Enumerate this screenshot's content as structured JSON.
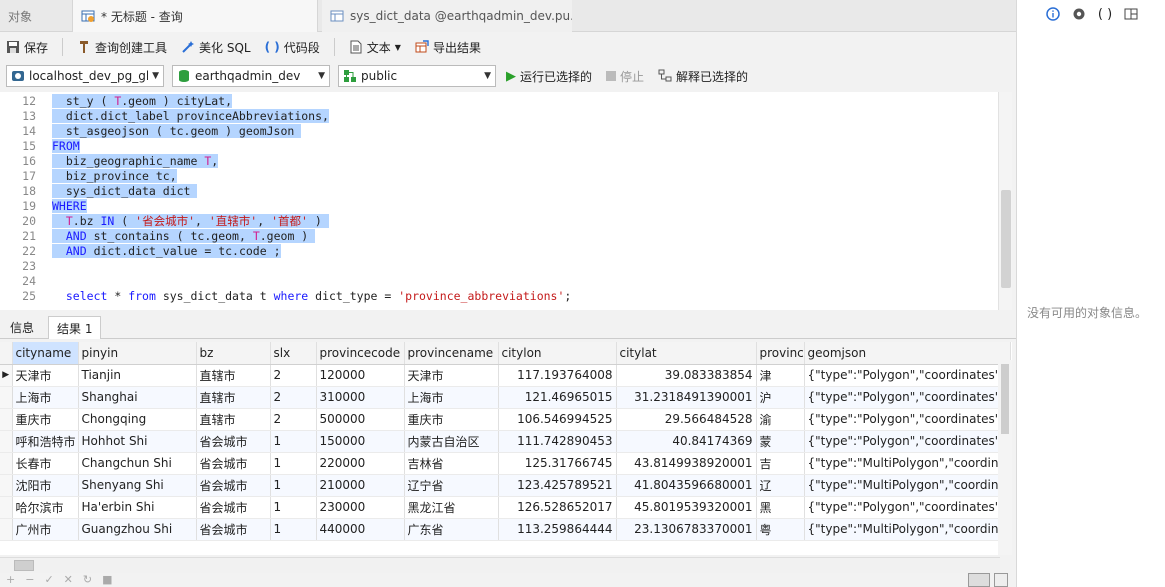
{
  "tabs": {
    "objects": "对象",
    "query": "* 无标题 - 查询",
    "dict": "sys_dict_data @earthqadmin_dev.pu..."
  },
  "toolbar": {
    "save": "保存",
    "query_builder": "查询创建工具",
    "beautify": "美化 SQL",
    "code_snippet": "代码段",
    "text": "文本",
    "export": "导出结果"
  },
  "connection": {
    "server": "localhost_dev_pg_gl",
    "database": "earthqadmin_dev",
    "schema": "public",
    "run": "运行已选择的",
    "stop": "停止",
    "explain": "解释已选择的"
  },
  "editor": {
    "line_numbers": [
      "12",
      "13",
      "14",
      "15",
      "16",
      "17",
      "18",
      "19",
      "20",
      "21",
      "22",
      "23",
      "24",
      "25"
    ]
  },
  "right_panel": {
    "message": "没有可用的对象信息。"
  },
  "result_tabs": {
    "info": "信息",
    "result": "结果 1"
  },
  "grid": {
    "columns": [
      "cityname",
      "pinyin",
      "bz",
      "slx",
      "provincecode",
      "provincename",
      "citylon",
      "citylat",
      "provinc",
      "geomjson"
    ],
    "rows": [
      [
        "天津市",
        "Tianjin",
        "直辖市",
        "2",
        "120000",
        "天津市",
        "117.193764008",
        "39.083383854",
        "津",
        "{\"type\":\"Polygon\",\"coordinates\":[["
      ],
      [
        "上海市",
        "Shanghai",
        "直辖市",
        "2",
        "310000",
        "上海市",
        "121.46965015",
        "31.2318491390001",
        "沪",
        "{\"type\":\"Polygon\",\"coordinates\":[["
      ],
      [
        "重庆市",
        "Chongqing",
        "直辖市",
        "2",
        "500000",
        "重庆市",
        "106.546994525",
        "29.566484528",
        "渝",
        "{\"type\":\"Polygon\",\"coordinates\":[["
      ],
      [
        "呼和浩特市",
        "Hohhot Shi",
        "省会城市",
        "1",
        "150000",
        "内蒙古自治区",
        "111.742890453",
        "40.84174369",
        "蒙",
        "{\"type\":\"Polygon\",\"coordinates\":[["
      ],
      [
        "长春市",
        "Changchun Shi",
        "省会城市",
        "1",
        "220000",
        "吉林省",
        "125.31766745",
        "43.8149938920001",
        "吉",
        "{\"type\":\"MultiPolygon\",\"coordinat"
      ],
      [
        "沈阳市",
        "Shenyang Shi",
        "省会城市",
        "1",
        "210000",
        "辽宁省",
        "123.425789521",
        "41.8043596680001",
        "辽",
        "{\"type\":\"MultiPolygon\",\"coordinat"
      ],
      [
        "哈尔滨市",
        "Ha'erbin Shi",
        "省会城市",
        "1",
        "230000",
        "黑龙江省",
        "126.528652017",
        "45.8019539320001",
        "黑",
        "{\"type\":\"Polygon\",\"coordinates\":[["
      ],
      [
        "广州市",
        "Guangzhou Shi",
        "省会城市",
        "1",
        "440000",
        "广东省",
        "113.259864444",
        "23.1306783370001",
        "粤",
        "{\"type\":\"MultiPolygon\",\"coordinat"
      ]
    ]
  }
}
